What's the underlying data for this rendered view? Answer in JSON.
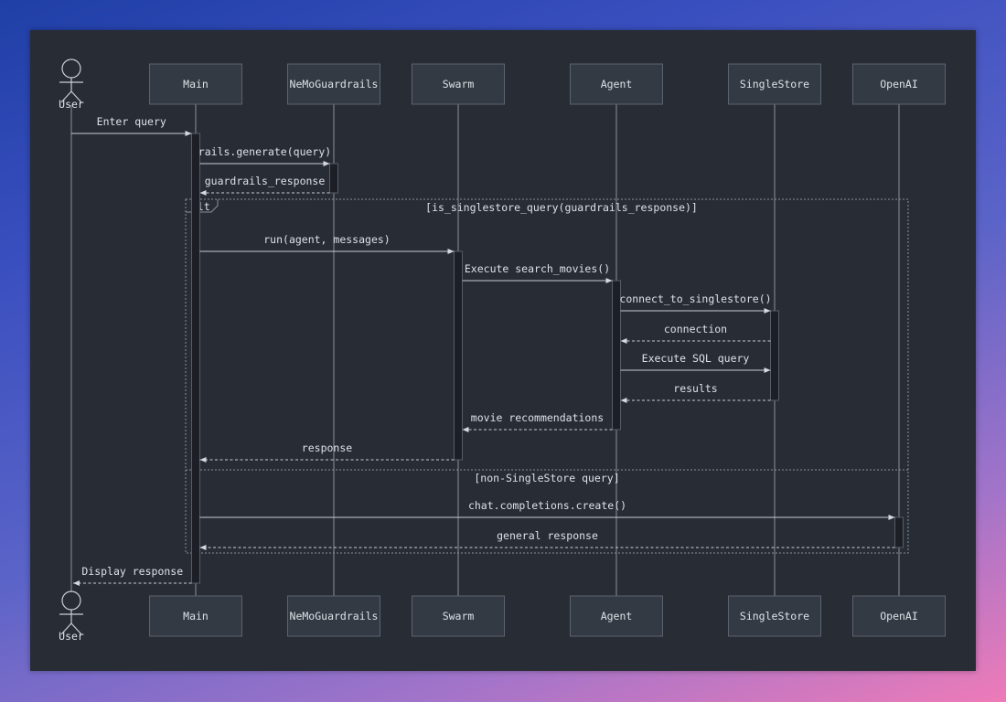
{
  "participants": [
    {
      "id": "user",
      "label": "User",
      "actor": true
    },
    {
      "id": "main",
      "label": "Main"
    },
    {
      "id": "nemo",
      "label": "NeMoGuardrails"
    },
    {
      "id": "swarm",
      "label": "Swarm"
    },
    {
      "id": "agent",
      "label": "Agent"
    },
    {
      "id": "singlestore",
      "label": "SingleStore"
    },
    {
      "id": "openai",
      "label": "OpenAI"
    }
  ],
  "messages": [
    {
      "from": "user",
      "to": "main",
      "label": "Enter query",
      "style": "solid"
    },
    {
      "from": "main",
      "to": "nemo",
      "label": "rails.generate(query)",
      "style": "solid"
    },
    {
      "from": "nemo",
      "to": "main",
      "label": "guardrails_response",
      "style": "dashed"
    },
    {
      "from": "main",
      "to": "swarm",
      "label": "run(agent, messages)",
      "style": "solid"
    },
    {
      "from": "swarm",
      "to": "agent",
      "label": "Execute search_movies()",
      "style": "solid"
    },
    {
      "from": "agent",
      "to": "singlestore",
      "label": "connect_to_singlestore()",
      "style": "solid"
    },
    {
      "from": "singlestore",
      "to": "agent",
      "label": "connection",
      "style": "dashed"
    },
    {
      "from": "agent",
      "to": "singlestore",
      "label": "Execute SQL query",
      "style": "solid"
    },
    {
      "from": "singlestore",
      "to": "agent",
      "label": "results",
      "style": "dashed"
    },
    {
      "from": "agent",
      "to": "swarm",
      "label": "movie recommendations",
      "style": "dashed"
    },
    {
      "from": "swarm",
      "to": "main",
      "label": "response",
      "style": "dashed"
    },
    {
      "from": "main",
      "to": "openai",
      "label": "chat.completions.create()",
      "style": "solid"
    },
    {
      "from": "openai",
      "to": "main",
      "label": "general response",
      "style": "dashed"
    },
    {
      "from": "main",
      "to": "user",
      "label": "Display response",
      "style": "dashed"
    }
  ],
  "alt_frame": {
    "keyword": "alt",
    "condition": "[is_singlestore_query(guardrails_response)]",
    "else_condition": "[non-SingleStore query]"
  },
  "colors": {
    "panel": "#282c34",
    "box": "#343a44",
    "text": "#dde1e7",
    "line": "#8a919d"
  }
}
